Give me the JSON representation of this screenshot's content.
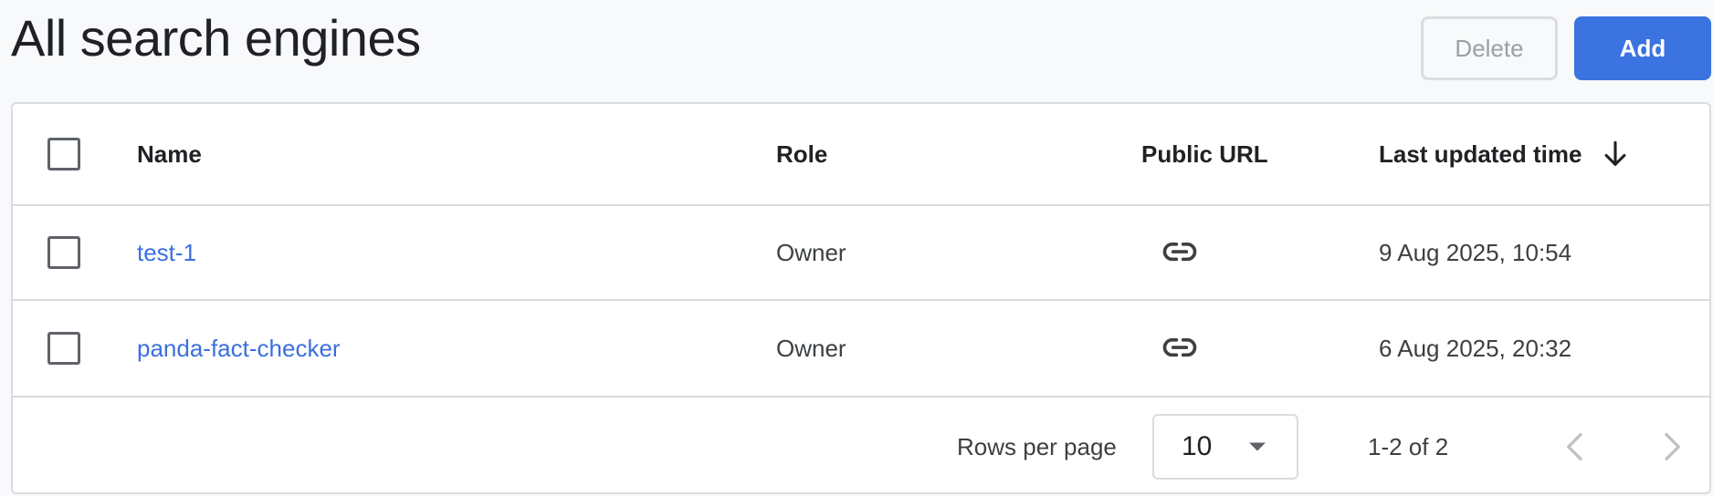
{
  "header": {
    "title": "All search engines",
    "delete_label": "Delete",
    "add_label": "Add"
  },
  "table": {
    "columns": {
      "name": "Name",
      "role": "Role",
      "public_url": "Public URL",
      "last_updated": "Last updated time"
    },
    "sort": {
      "column": "last_updated",
      "direction": "descending",
      "icon": "arrow-down-icon"
    },
    "rows": [
      {
        "name": "test-1",
        "role": "Owner",
        "public_url_icon": "link-icon",
        "last_updated": "9 Aug 2025, 10:54"
      },
      {
        "name": "panda-fact-checker",
        "role": "Owner",
        "public_url_icon": "link-icon",
        "last_updated": "6 Aug 2025, 20:32"
      }
    ]
  },
  "pagination": {
    "rows_per_page_label": "Rows per page",
    "rows_per_page_value": "10",
    "range_text": "1-2 of 2",
    "prev_icon": "chevron-left-icon",
    "next_icon": "chevron-right-icon"
  },
  "colors": {
    "accent": "#3b74e0",
    "link": "#3b6fe0",
    "border": "#dadce0",
    "background": "#f8f9fa"
  }
}
